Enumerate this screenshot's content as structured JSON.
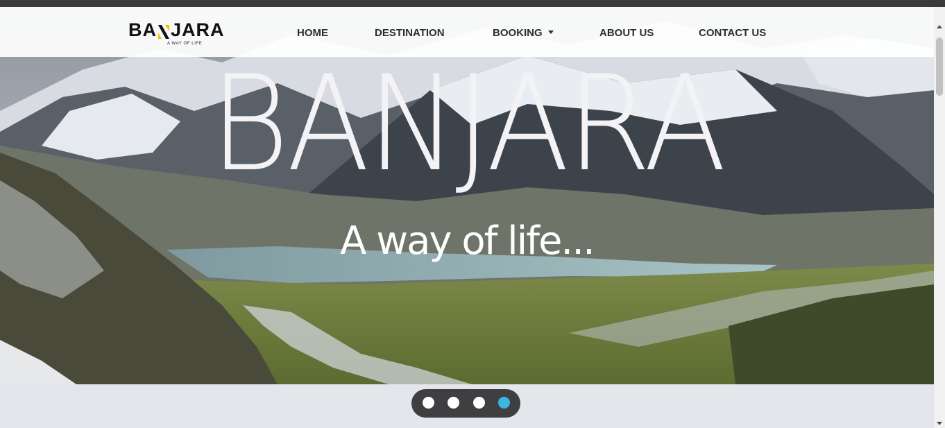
{
  "brand": {
    "logo_left": "BA",
    "logo_right": "JARA",
    "tagline": "A WAY OF LIFE",
    "accent_color": "#f2c200"
  },
  "nav": {
    "items": [
      {
        "label": "HOME"
      },
      {
        "label": "DESTINATION"
      },
      {
        "label": "BOOKING"
      },
      {
        "label": "ABOUT US"
      },
      {
        "label": "CONTACT US"
      }
    ]
  },
  "hero": {
    "title": "BANJARA",
    "subtitle": "A way of life...",
    "image": "mountain-valley-lake-scenery"
  },
  "carousel": {
    "slide_count": 4,
    "active_index": 3,
    "active_color": "#3cb6e0"
  },
  "icons": {
    "booking_dropdown": "caret-down-icon"
  }
}
